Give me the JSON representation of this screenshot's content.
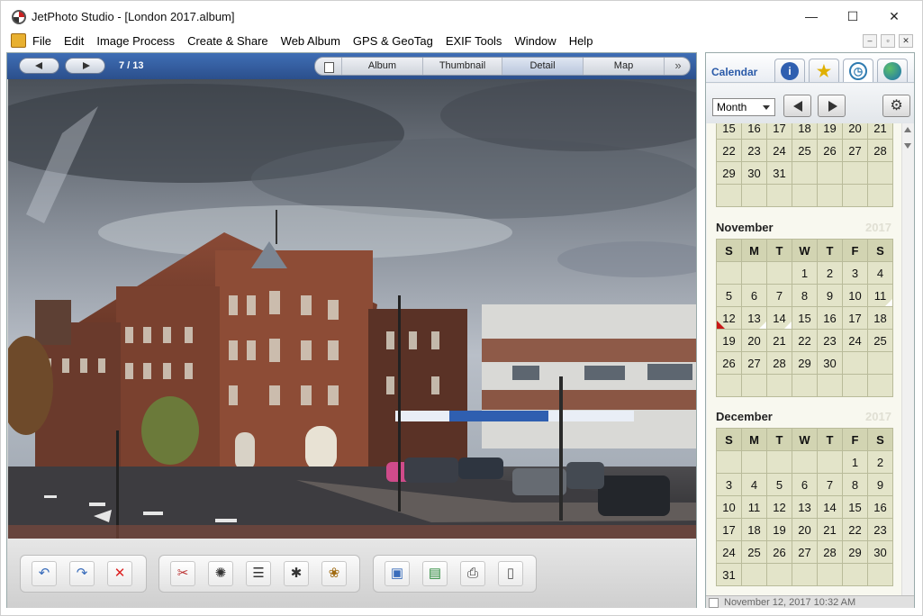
{
  "window": {
    "title": "JetPhoto Studio - [London 2017.album]",
    "controls": {
      "minimize": "—",
      "maximize": "☐",
      "close": "✕"
    }
  },
  "menu": {
    "items": [
      "File",
      "Edit",
      "Image Process",
      "Create & Share",
      "Web Album",
      "GPS & GeoTag",
      "EXIF Tools",
      "Window",
      "Help"
    ]
  },
  "mdi_controls": [
    "–",
    "▫",
    "✕"
  ],
  "viewer": {
    "page_counter": "7 / 13",
    "tabs": [
      "Album",
      "Thumbnail",
      "Detail",
      "Map"
    ],
    "active_tab": "Detail",
    "more_tabs": "»",
    "photo_description_icon": "photo-icon"
  },
  "toolbar": {
    "groups": [
      {
        "buttons": [
          {
            "name": "undo-icon",
            "glyph": "↶"
          },
          {
            "name": "redo-icon",
            "glyph": "↷"
          },
          {
            "name": "delete-icon",
            "glyph": "✕"
          }
        ]
      },
      {
        "buttons": [
          {
            "name": "crop-icon",
            "glyph": "✂"
          },
          {
            "name": "rotate-icon",
            "glyph": "✺"
          },
          {
            "name": "adjust-icon",
            "glyph": "☰"
          },
          {
            "name": "filter-icon",
            "glyph": "✱"
          },
          {
            "name": "effect-icon",
            "glyph": "❀"
          }
        ]
      },
      {
        "buttons": [
          {
            "name": "slideshow-icon",
            "glyph": "▣"
          },
          {
            "name": "wallpaper-icon",
            "glyph": "▤"
          },
          {
            "name": "print-icon",
            "glyph": "⎙"
          },
          {
            "name": "mobile-icon",
            "glyph": "▯"
          }
        ]
      }
    ]
  },
  "calendar_panel": {
    "title": "Calendar",
    "tab_icons": [
      "info-icon",
      "star-icon",
      "clock-icon",
      "globe-icon"
    ],
    "view_select": "Month",
    "partial_month": {
      "rows": [
        [
          "15",
          "16",
          "17",
          "18",
          "19",
          "20",
          "21"
        ],
        [
          "22",
          "23",
          "24",
          "25",
          "26",
          "27",
          "28"
        ],
        [
          "29",
          "30",
          "31",
          "",
          "",
          "",
          ""
        ],
        [
          "",
          "",
          "",
          "",
          "",
          "",
          ""
        ]
      ]
    },
    "months": [
      {
        "name": "November",
        "year": "2017",
        "weekdays": [
          "S",
          "M",
          "T",
          "W",
          "T",
          "F",
          "S"
        ],
        "rows": [
          [
            "",
            "",
            "",
            "1",
            "2",
            "3",
            "4"
          ],
          [
            "5",
            "6",
            "7",
            "8",
            "9",
            "10",
            "11"
          ],
          [
            "12",
            "13",
            "14",
            "15",
            "16",
            "17",
            "18"
          ],
          [
            "19",
            "20",
            "21",
            "22",
            "23",
            "24",
            "25"
          ],
          [
            "26",
            "27",
            "28",
            "29",
            "30",
            "",
            ""
          ],
          [
            "",
            "",
            "",
            "",
            "",
            "",
            ""
          ]
        ]
      },
      {
        "name": "December",
        "year": "2017",
        "weekdays": [
          "S",
          "M",
          "T",
          "W",
          "T",
          "F",
          "S"
        ],
        "rows": [
          [
            "",
            "",
            "",
            "",
            "",
            "1",
            "2"
          ],
          [
            "3",
            "4",
            "5",
            "6",
            "7",
            "8",
            "9"
          ],
          [
            "10",
            "11",
            "12",
            "13",
            "14",
            "15",
            "16"
          ],
          [
            "17",
            "18",
            "19",
            "20",
            "21",
            "22",
            "23"
          ],
          [
            "24",
            "25",
            "26",
            "27",
            "28",
            "29",
            "30"
          ],
          [
            "31",
            "",
            "",
            "",
            "",
            "",
            ""
          ]
        ]
      }
    ],
    "status": "November 12, 2017 10:32 AM"
  }
}
